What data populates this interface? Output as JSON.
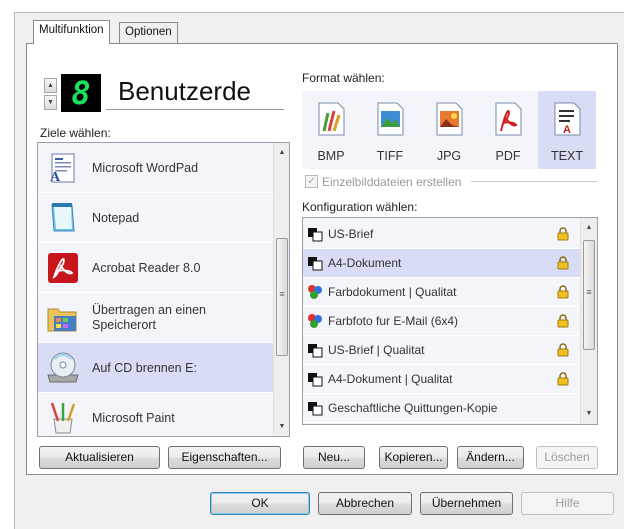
{
  "tabs": [
    {
      "label": "Multifunktion",
      "active": true
    },
    {
      "label": "Optionen",
      "active": false
    }
  ],
  "profile": {
    "number": "8",
    "name": "Benutzerde"
  },
  "destinations": {
    "label": "Ziele wählen:",
    "items": [
      {
        "label": "Microsoft WordPad",
        "icon": "wordpad-icon",
        "selected": false
      },
      {
        "label": "Notepad",
        "icon": "notepad-icon",
        "selected": false
      },
      {
        "label": "Acrobat Reader 8.0",
        "icon": "acrobat-icon",
        "selected": false
      },
      {
        "label": "Übertragen an einen Speicherort",
        "icon": "folder-icon",
        "selected": false
      },
      {
        "label": "Auf CD brennen  E:",
        "icon": "cd-drive-icon",
        "selected": true
      },
      {
        "label": "Microsoft Paint",
        "icon": "paint-icon",
        "selected": false
      }
    ]
  },
  "format": {
    "label": "Format wählen:",
    "items": [
      {
        "label": "BMP",
        "icon": "bmp-icon",
        "selected": false
      },
      {
        "label": "TIFF",
        "icon": "tiff-icon",
        "selected": false
      },
      {
        "label": "JPG",
        "icon": "jpg-icon",
        "selected": false
      },
      {
        "label": "PDF",
        "icon": "pdf-icon",
        "selected": false
      },
      {
        "label": "TEXT",
        "icon": "text-icon",
        "selected": true
      }
    ]
  },
  "single_files": {
    "label": "Einzelbilddateien erstellen",
    "checked": true,
    "enabled": false
  },
  "configuration": {
    "label": "Konfiguration wählen:",
    "items": [
      {
        "label": "US-Brief",
        "icon": "bw-document-icon",
        "locked": true,
        "selected": false
      },
      {
        "label": "A4-Dokument",
        "icon": "bw-document-icon",
        "locked": true,
        "selected": true
      },
      {
        "label": "Farbdokument | Qualitat",
        "icon": "color-document-icon",
        "locked": true,
        "selected": false
      },
      {
        "label": "Farbfoto fur E-Mail (6x4)",
        "icon": "color-document-icon",
        "locked": true,
        "selected": false
      },
      {
        "label": "US-Brief | Qualitat",
        "icon": "bw-document-icon",
        "locked": true,
        "selected": false
      },
      {
        "label": "A4-Dokument | Qualitat",
        "icon": "bw-document-icon",
        "locked": true,
        "selected": false
      },
      {
        "label": "Geschaftliche Quittungen-Kopie",
        "icon": "bw-document-icon",
        "locked": false,
        "selected": false
      }
    ]
  },
  "buttons": {
    "refresh": "Aktualisieren",
    "properties": "Eigenschaften...",
    "new": "Neu...",
    "copy": "Kopieren...",
    "edit": "Ändern...",
    "delete": "Löschen",
    "ok": "OK",
    "cancel": "Abbrechen",
    "apply": "Übernehmen",
    "help": "Hilfe"
  },
  "colors": {
    "selection": "#d9dcf5",
    "list_bg": "#f4f5fb",
    "lcd_digit": "#19e35c",
    "lock": "#f0c020"
  }
}
